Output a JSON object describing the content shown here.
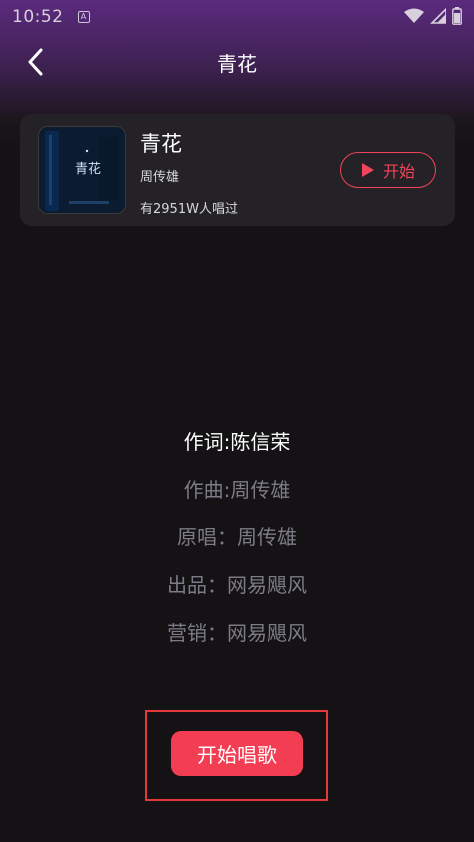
{
  "status_bar": {
    "time": "10:52",
    "notification_letter": "A"
  },
  "header": {
    "title": "青花"
  },
  "song": {
    "title": "青花",
    "artist": "周传雄",
    "sing_count": "有2951W人唱过",
    "start_label": "开始",
    "cover_text": "青花"
  },
  "credits": {
    "lyricist": "作词:陈信荣",
    "composer": "作曲:周传雄",
    "original_singer": "原唱：周传雄",
    "producer": "出品：网易飓风",
    "marketing": "营销：网易飓风"
  },
  "actions": {
    "start_singing_label": "开始唱歌"
  },
  "colors": {
    "accent": "#f23d53",
    "card_bg": "#242226",
    "page_bg": "#141214",
    "header_purple": "#5b2a7e"
  },
  "icons": [
    "back-icon",
    "play-icon",
    "wifi-icon",
    "signal-icon",
    "battery-icon"
  ]
}
